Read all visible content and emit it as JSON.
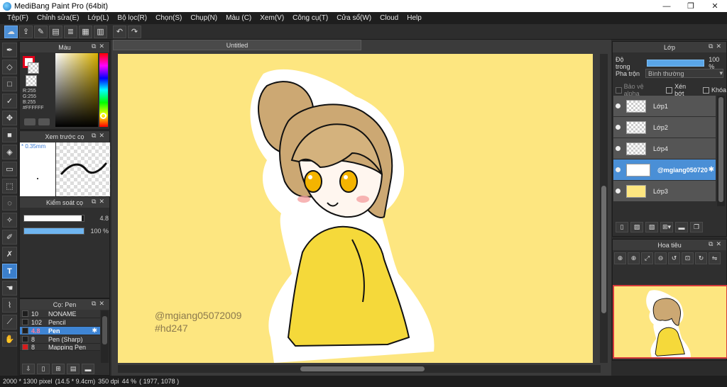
{
  "window": {
    "title": "MediBang Paint Pro (64bit)",
    "controls": {
      "minimize": "—",
      "maximize": "❐",
      "close": "✕"
    }
  },
  "menu": [
    "Tệp(F)",
    "Chỉnh sửa(E)",
    "Lớp(L)",
    "Bộ lọc(R)",
    "Chọn(S)",
    "Chụp(N)",
    "Màu (C)",
    "Xem(V)",
    "Công cụ(T)",
    "Cửa sổ(W)",
    "Cloud",
    "Help"
  ],
  "toolbar_icons": [
    "cloud-icon",
    "share-icon",
    "comment-icon",
    "document-icon",
    "list-icon",
    "grid-icon",
    "panel-icon",
    "undo-icon",
    "redo-icon"
  ],
  "color_panel": {
    "title": "Màu",
    "readout_r": "R:255",
    "readout_g": "G:255",
    "readout_b": "B:255",
    "hex": "#FFFFFF",
    "foreground_color": "#ffffff",
    "foreground_border": "#e1001a"
  },
  "preview_panel": {
    "title": "Xem trước cọ",
    "size": "* 0.35mm"
  },
  "brush_control": {
    "title": "Kiểm soát cọ",
    "size_value": "4.8",
    "size_fraction": 0.96,
    "opacity_value": "100 %",
    "opacity_fraction": 1.0
  },
  "brush_panel": {
    "title": "Cọ: Pen",
    "items": [
      {
        "num": "10",
        "name": "NONAME",
        "chip": "#1e1e1e",
        "active": false
      },
      {
        "num": "102",
        "name": "Pencil",
        "chip": "#1e1e1e",
        "active": false
      },
      {
        "num": "4.8",
        "name": "Pen",
        "chip": "#1e1e1e",
        "active": true
      },
      {
        "num": "8",
        "name": "Pen (Sharp)",
        "chip": "#1e1e1e",
        "active": false
      },
      {
        "num": "8",
        "name": "Mapping Pen",
        "chip": "#d71d1d",
        "active": false
      }
    ]
  },
  "canvas": {
    "tab_title": "Untitled",
    "watermark_line1": "@mgiang05072009",
    "watermark_line2": "#hd247",
    "background_color": "#fde680"
  },
  "layer_panel": {
    "title": "Lớp",
    "opacity_label": "Độ trong",
    "opacity_value": "100 %",
    "blend_label": "Pha trộn",
    "blend_value": "Bình thường",
    "protect_alpha": "Bảo vệ alpha",
    "clipping": "Xén bớt",
    "lock": "Khóa",
    "layers": [
      {
        "name": "Lớp1",
        "active": false,
        "thumb": "checker"
      },
      {
        "name": "Lớp2",
        "active": false,
        "thumb": "checker"
      },
      {
        "name": "Lớp4",
        "active": false,
        "thumb": "checker"
      },
      {
        "name": "@mgiang050720",
        "active": true,
        "thumb": "white"
      },
      {
        "name": "Lớp3",
        "active": false,
        "thumb": "yellow"
      }
    ]
  },
  "navigator_panel": {
    "title": "Hoa tiêu",
    "tools": [
      "zoom-fit-icon",
      "zoom-in-icon",
      "fit-window-icon",
      "zoom-out-icon",
      "rotate-left-icon",
      "actual-size-icon",
      "rotate-right-icon",
      "flip-icon"
    ]
  },
  "status": {
    "canvas_size": "2000 * 1300 pixel",
    "physical_size": "(14.5 * 9.4cm)",
    "dpi": "350 dpi",
    "zoom": "44 %",
    "cursor": "( 1977, 1078 )"
  }
}
